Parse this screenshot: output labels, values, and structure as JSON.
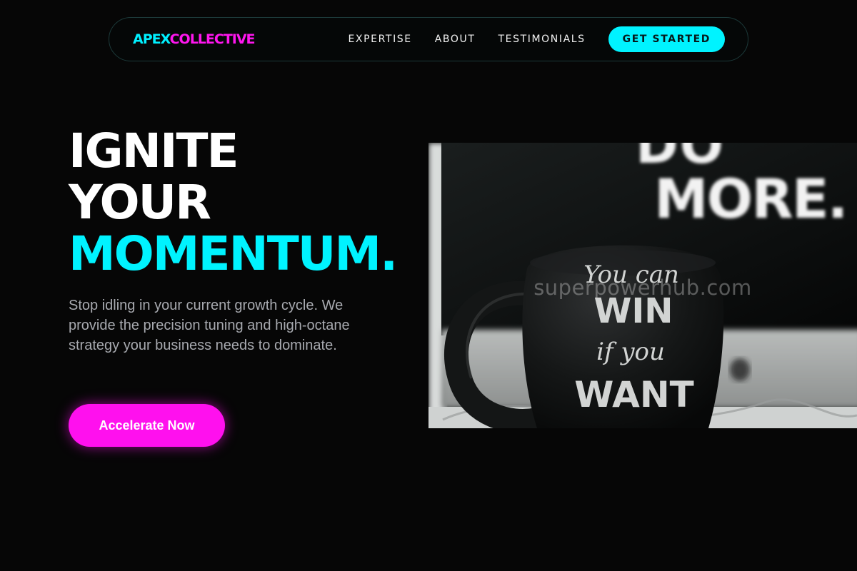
{
  "brand": {
    "part1": "APEX",
    "part2": "COLLECTIVE",
    "color1": "#00f0ff",
    "color2": "#ff16ee"
  },
  "nav": {
    "links": [
      "EXPERTISE",
      "ABOUT",
      "TESTIMONIALS"
    ],
    "cta_label": "GET STARTED"
  },
  "hero": {
    "headline_line1": "IGNITE",
    "headline_line2": "YOUR",
    "headline_line3": "MOMENTUM.",
    "subtitle": "Stop idling in your current growth cycle. We provide the precision tuning and high-octane strategy your business needs to dominate.",
    "cta_label": "Accelerate Now"
  },
  "image": {
    "background_sign_text_line1": "DO",
    "background_sign_text_line2": "MORE.",
    "mug_text_line1": "You can",
    "mug_text_line2": "WIN",
    "mug_text_line3": "if you",
    "mug_text_line4": "WANT",
    "watermark": "superpowerhub.com"
  },
  "colors": {
    "background": "#060606",
    "accent_cyan": "#00f3ff",
    "accent_magenta": "#ff10ee",
    "body_text": "#a8aab0"
  }
}
